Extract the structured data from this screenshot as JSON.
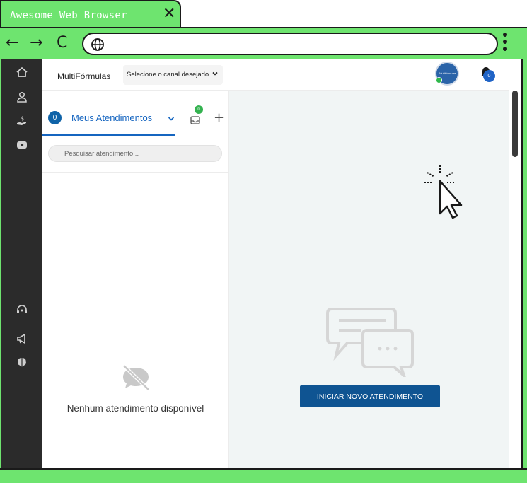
{
  "browser": {
    "tab_title": "Awesome Web Browser",
    "close_glyph": "✕",
    "back_glyph": "←",
    "forward_glyph": "→",
    "reload_glyph": "C",
    "url": ""
  },
  "sidebar": {
    "items": [
      {
        "icon": "home-icon"
      },
      {
        "icon": "user-icon"
      },
      {
        "icon": "money-hand-icon"
      },
      {
        "icon": "youtube-icon"
      },
      {
        "icon": "headset-icon"
      },
      {
        "icon": "megaphone-icon"
      },
      {
        "icon": "brain-icon"
      }
    ]
  },
  "header": {
    "brand": "MultiFórmulas",
    "channel_select": "Selecione o canal desejado",
    "avatar_text": "Multifórmulas",
    "notifications_count": "0"
  },
  "left_panel": {
    "count": "0",
    "tab_label": "Meus Atendimentos",
    "queue_badge": "0",
    "search_placeholder": "Pesquisar atendimento...",
    "empty_text": "Nenhum atendimento disponível"
  },
  "main": {
    "start_button": "INICIAR NOVO ATENDIMENTO"
  },
  "colors": {
    "browser_green": "#6ee46f",
    "sidebar_dark": "#2b2b2b",
    "accent_blue": "#1565c0",
    "button_blue": "#0f5492",
    "online_green": "#2fb84b"
  }
}
